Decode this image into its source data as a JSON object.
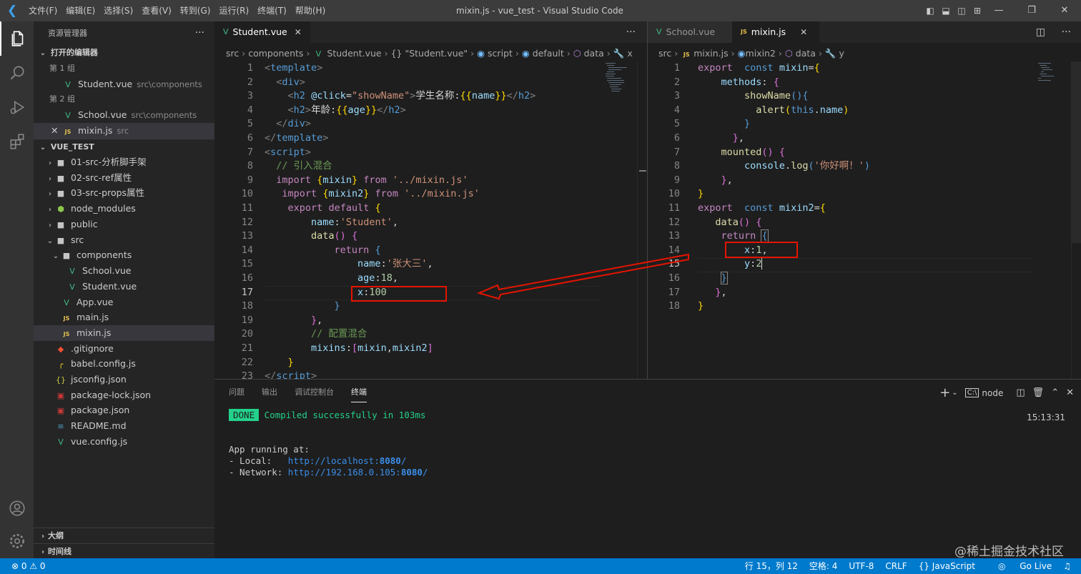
{
  "title_bar": {
    "logo": "vscode-logo",
    "menu": [
      "文件(F)",
      "编辑(E)",
      "选择(S)",
      "查看(V)",
      "转到(G)",
      "运行(R)",
      "终端(T)",
      "帮助(H)"
    ],
    "window_title": "mixin.js - vue_test - Visual Studio Code",
    "layout_icons": [
      "◧",
      "⬓",
      "◫",
      "⊞"
    ],
    "window_controls": [
      "—",
      "❐",
      "✕"
    ]
  },
  "activity_bar": [
    "explorer-icon",
    "search-icon",
    "run-debug-icon",
    "extensions-icon",
    "account-icon",
    "settings-gear-icon"
  ],
  "sidebar": {
    "header": "资源管理器",
    "more": "···",
    "open_editors": {
      "title": "打开的编辑器",
      "group1": "第 1 组",
      "g1_file": {
        "name": "Student.vue",
        "desc": "src\\components"
      },
      "group2": "第 2 组",
      "g2_file1": {
        "name": "School.vue",
        "desc": "src\\components"
      },
      "g2_file2": {
        "name": "mixin.js",
        "desc": "src"
      }
    },
    "project": {
      "title": "VUE_TEST",
      "items": [
        "01-src-分析脚手架",
        "02-src-ref属性",
        "03-src-props属性",
        "node_modules",
        "public",
        "src",
        "components",
        "School.vue",
        "Student.vue",
        "App.vue",
        "main.js",
        "mixin.js",
        ".gitignore",
        "babel.config.js",
        "jsconfig.json",
        "package-lock.json",
        "package.json",
        "README.md",
        "vue.config.js"
      ]
    },
    "outline": "大纲",
    "timeline": "时间线"
  },
  "left_editor": {
    "tab": "Student.vue",
    "breadcrumb": [
      "src",
      "components",
      "Student.vue",
      "{} \"Student.vue\"",
      "script",
      "default",
      "data",
      "x"
    ],
    "current_line": 17
  },
  "right_editor": {
    "tabs": [
      "School.vue",
      "mixin.js"
    ],
    "active_tab": "mixin.js",
    "breadcrumb": [
      "src",
      "mixin.js",
      "mixin2",
      "data",
      "y"
    ],
    "current_line": 15
  },
  "panel": {
    "tabs": [
      "问题",
      "输出",
      "调试控制台",
      "终端"
    ],
    "active_tab": "终端",
    "terminal_name": "node",
    "time": "15:13:31",
    "done_badge": "DONE",
    "compiled": "Compiled successfully in 103ms",
    "app_running": "App running at:",
    "local_label": "- Local:   ",
    "local_url_a": "http://localhost:",
    "local_port": "8080",
    "local_url_b": "/",
    "network_label": "- Network: ",
    "network_url_a": "http://192.168.0.105:",
    "network_port": "8080",
    "network_url_b": "/"
  },
  "status_bar": {
    "errors": "⊗ 0 ⚠ 0",
    "position": "行 15，列 12",
    "spaces": "空格: 4",
    "encoding": "UTF-8",
    "eol": "CRLF",
    "language": "{} JavaScript",
    "golive": "Go Live",
    "bell": "🔔"
  },
  "watermark": "@稀土掘金技术社区",
  "colors": {
    "accent": "#007acc",
    "annotation": "#e51400",
    "done": "#23d18b"
  }
}
